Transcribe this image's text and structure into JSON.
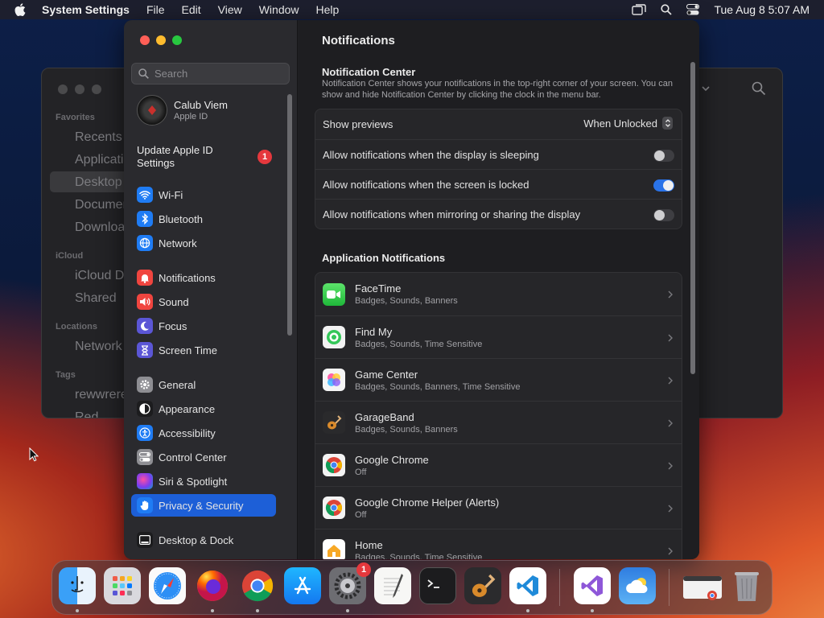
{
  "menubar": {
    "app_name": "System Settings",
    "menus": [
      "File",
      "Edit",
      "View",
      "Window",
      "Help"
    ],
    "clock": "Tue Aug 8  5:07 AM"
  },
  "finder": {
    "sections": {
      "favorites": "Favorites",
      "icloud": "iCloud",
      "locations": "Locations",
      "tags": "Tags"
    },
    "items": [
      "Recents",
      "Applicatio",
      "Desktop",
      "Documen",
      "Downloads",
      "iCloud Dri",
      "Shared",
      "Network",
      "rewwrerer",
      "Red"
    ]
  },
  "settings": {
    "search_placeholder": "Search",
    "account": {
      "name": "Calub Viem",
      "subtitle": "Apple ID"
    },
    "update": {
      "label": "Update Apple ID Settings",
      "badge": "1"
    },
    "sidebar": [
      {
        "label": "Wi-Fi",
        "icon": "wifi-icon",
        "color": "#1f7cf4"
      },
      {
        "label": "Bluetooth",
        "icon": "bluetooth-icon",
        "color": "#1f7cf4"
      },
      {
        "label": "Network",
        "icon": "globe-icon",
        "color": "#1f7cf4"
      },
      {
        "label": "Notifications",
        "icon": "bell-icon",
        "color": "#f0453f"
      },
      {
        "label": "Sound",
        "icon": "speaker-icon",
        "color": "#f0453f"
      },
      {
        "label": "Focus",
        "icon": "moon-icon",
        "color": "#5b56d6"
      },
      {
        "label": "Screen Time",
        "icon": "hourglass-icon",
        "color": "#5b56d6"
      },
      {
        "label": "General",
        "icon": "gear-icon",
        "color": "#8e8e93"
      },
      {
        "label": "Appearance",
        "icon": "appearance-icon",
        "color": "#1c1c1e"
      },
      {
        "label": "Accessibility",
        "icon": "accessibility-icon",
        "color": "#1f7cf4"
      },
      {
        "label": "Control Center",
        "icon": "control-center-icon",
        "color": "#8e8e93"
      },
      {
        "label": "Siri & Spotlight",
        "icon": "siri-icon",
        "color": "#c33ad6"
      },
      {
        "label": "Privacy & Security",
        "icon": "hand-icon",
        "color": "#1f7cf4"
      },
      {
        "label": "Desktop & Dock",
        "icon": "dock-icon",
        "color": "#1c1c1e"
      }
    ],
    "main": {
      "title": "Notifications",
      "nc_title": "Notification Center",
      "nc_desc": "Notification Center shows your notifications in the top-right corner of your screen. You can show and hide Notification Center by clicking the clock in the menu bar.",
      "show_previews_label": "Show previews",
      "show_previews_value": "When Unlocked",
      "toggles": [
        {
          "label": "Allow notifications when the display is sleeping",
          "on": false
        },
        {
          "label": "Allow notifications when the screen is locked",
          "on": true
        },
        {
          "label": "Allow notifications when mirroring or sharing the display",
          "on": false
        }
      ],
      "apps_title": "Application Notifications",
      "apps": [
        {
          "name": "FaceTime",
          "detail": "Badges, Sounds, Banners",
          "icon": "facetime-icon"
        },
        {
          "name": "Find My",
          "detail": "Badges, Sounds, Time Sensitive",
          "icon": "find-my-icon"
        },
        {
          "name": "Game Center",
          "detail": "Badges, Sounds, Banners, Time Sensitive",
          "icon": "game-center-icon"
        },
        {
          "name": "GarageBand",
          "detail": "Badges, Sounds, Banners",
          "icon": "garageband-icon"
        },
        {
          "name": "Google Chrome",
          "detail": "Off",
          "icon": "chrome-icon"
        },
        {
          "name": "Google Chrome Helper (Alerts)",
          "detail": "Off",
          "icon": "chrome-icon"
        },
        {
          "name": "Home",
          "detail": "Badges, Sounds, Time Sensitive",
          "icon": "home-icon"
        }
      ]
    }
  },
  "dock": {
    "apps": [
      "Finder",
      "Launchpad",
      "Safari",
      "Firefox",
      "Google Chrome",
      "App Store",
      "System Settings",
      "TextEdit",
      "Terminal",
      "GarageBand",
      "Visual Studio Code",
      "Visual Studio",
      "Weather",
      "Chrome Window",
      "Trash"
    ],
    "settings_badge": "1"
  }
}
